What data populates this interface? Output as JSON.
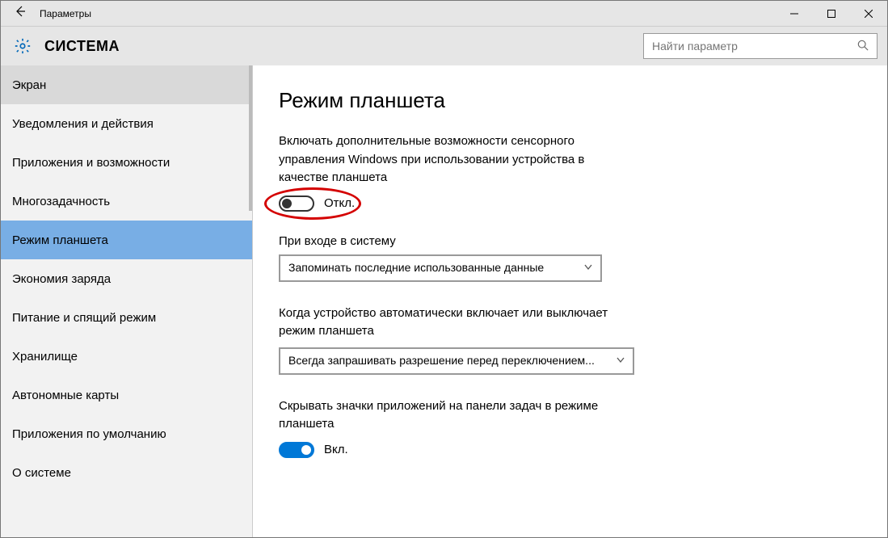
{
  "window": {
    "title": "Параметры"
  },
  "header": {
    "heading": "СИСТЕМА",
    "search_placeholder": "Найти параметр"
  },
  "sidebar": {
    "items": [
      "Экран",
      "Уведомления и действия",
      "Приложения и возможности",
      "Многозадачность",
      "Режим планшета",
      "Экономия заряда",
      "Питание и спящий режим",
      "Хранилище",
      "Автономные карты",
      "Приложения по умолчанию",
      "О системе"
    ],
    "selected_index": 4
  },
  "main": {
    "title": "Режим планшета",
    "toggle1_desc": "Включать дополнительные возможности сенсорного управления Windows при использовании устройства в качестве планшета",
    "toggle1_state": "Откл.",
    "signin_label": "При входе в систему",
    "signin_value": "Запоминать последние использованные данные",
    "auto_label": "Когда устройство автоматически включает или выключает режим планшета",
    "auto_value": "Всегда запрашивать разрешение перед переключением...",
    "hide_icons_label": "Скрывать значки приложений на панели задач в режиме планшета",
    "hide_icons_state": "Вкл."
  }
}
